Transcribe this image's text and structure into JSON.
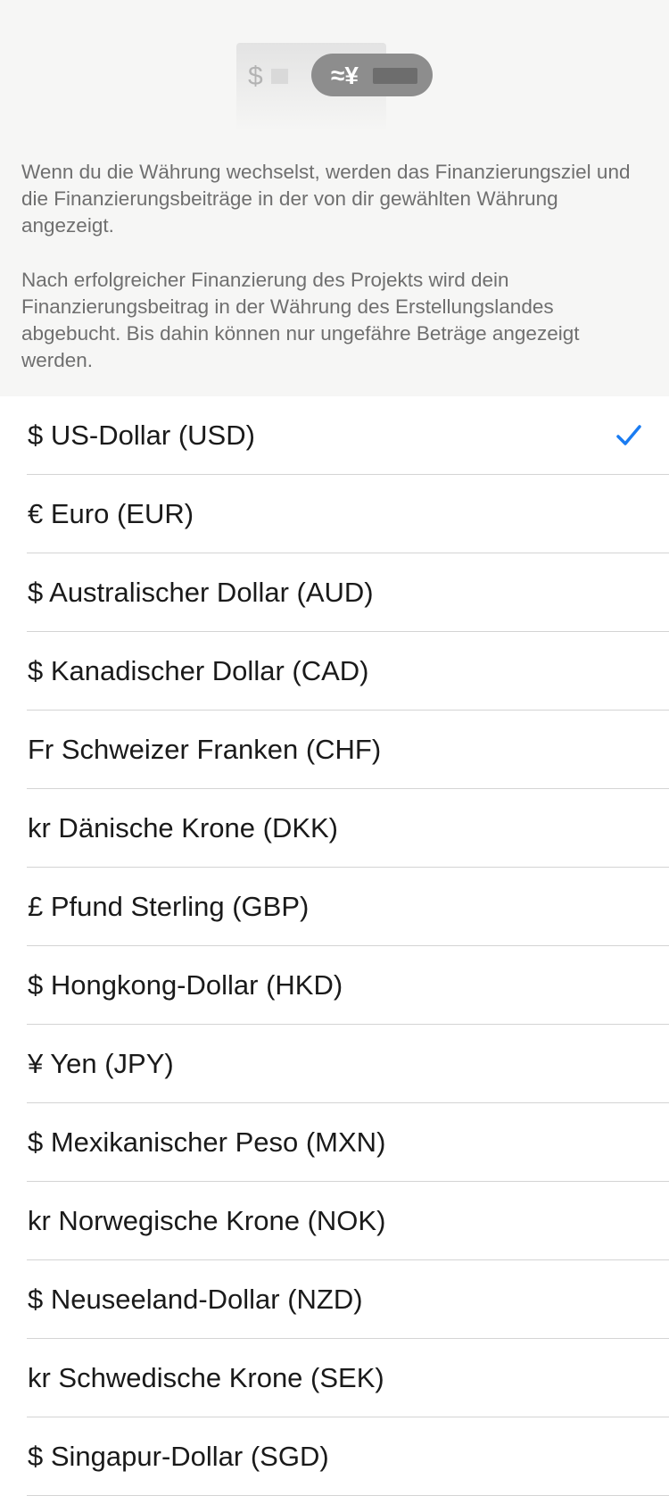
{
  "illustration": {
    "dollar_symbol": "$",
    "yen_symbol": "≈¥"
  },
  "info": {
    "paragraph1": "Wenn du die Währung wechselst, werden das Finanzierungsziel und die Finanzierungsbeiträge in der von dir gewählten Währung angezeigt.",
    "paragraph2": "Nach erfolgreicher Finanzierung des Projekts wird dein Finanzierungsbeitrag in der Währung des Erstellungslandes abgebucht. Bis dahin können nur ungefähre Beträge angezeigt werden."
  },
  "currencies": [
    {
      "label": "$ US-Dollar (USD)",
      "selected": true
    },
    {
      "label": "€ Euro (EUR)",
      "selected": false
    },
    {
      "label": "$ Australischer Dollar (AUD)",
      "selected": false
    },
    {
      "label": "$ Kanadischer Dollar (CAD)",
      "selected": false
    },
    {
      "label": "Fr Schweizer Franken (CHF)",
      "selected": false
    },
    {
      "label": "kr Dänische Krone (DKK)",
      "selected": false
    },
    {
      "label": "£ Pfund Sterling (GBP)",
      "selected": false
    },
    {
      "label": "$ Hongkong-Dollar (HKD)",
      "selected": false
    },
    {
      "label": "¥ Yen (JPY)",
      "selected": false
    },
    {
      "label": "$ Mexikanischer Peso (MXN)",
      "selected": false
    },
    {
      "label": "kr Norwegische Krone (NOK)",
      "selected": false
    },
    {
      "label": "$ Neuseeland-Dollar (NZD)",
      "selected": false
    },
    {
      "label": "kr Schwedische Krone (SEK)",
      "selected": false
    },
    {
      "label": "$ Singapur-Dollar (SGD)",
      "selected": false
    }
  ],
  "colors": {
    "accent": "#1a7cf2",
    "header_bg": "#f6f6f5",
    "body_text": "#6f6f6f"
  }
}
